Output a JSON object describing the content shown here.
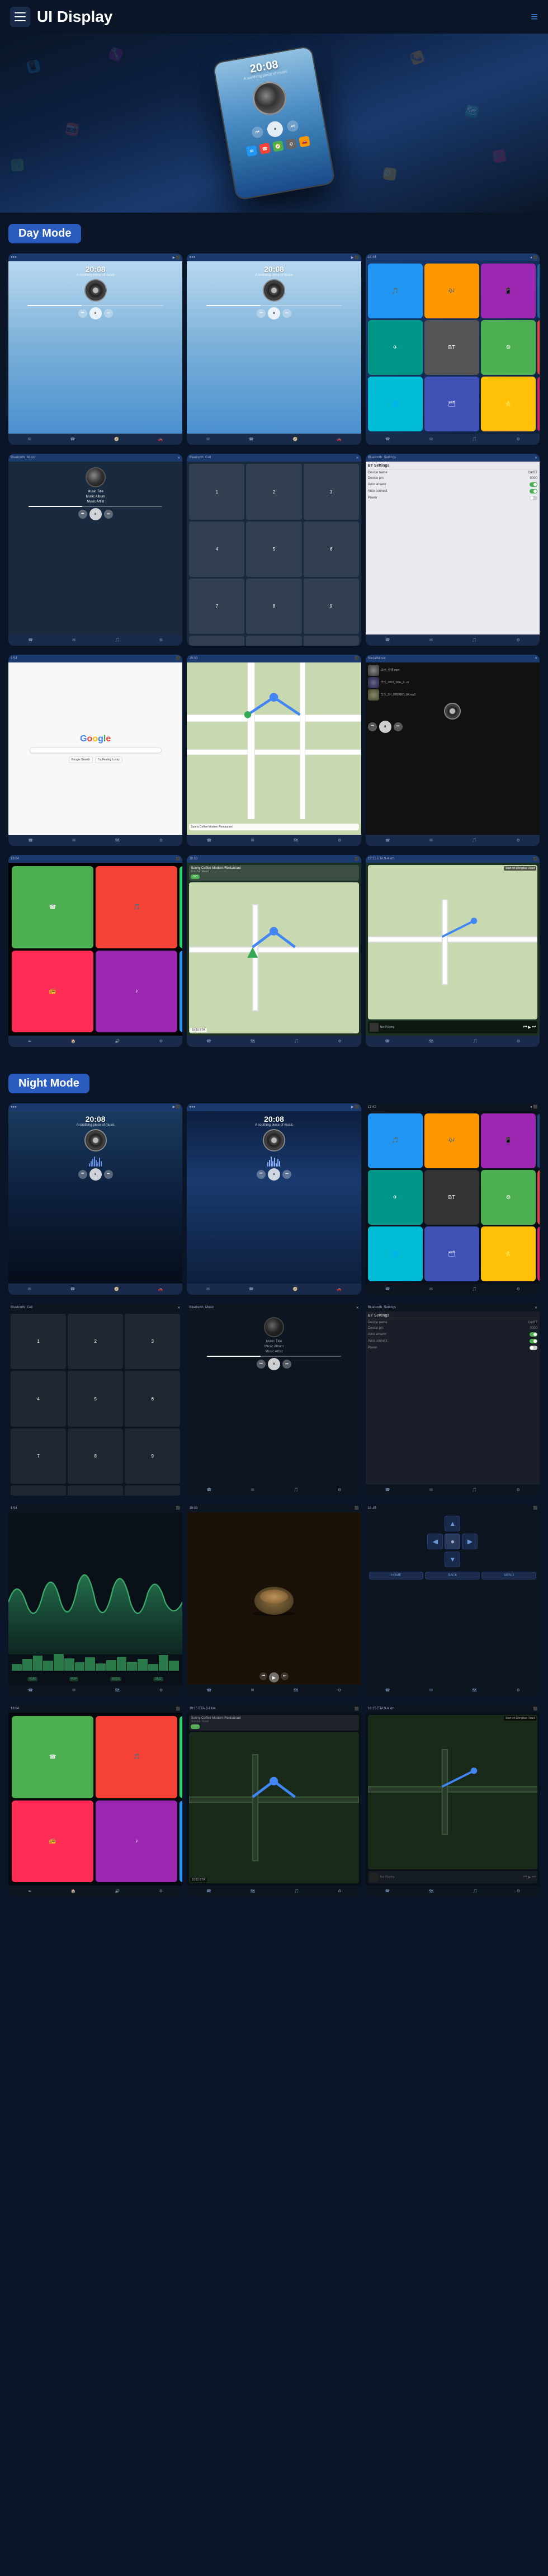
{
  "header": {
    "title": "UI Display",
    "menu_label": "menu",
    "nav_icon": "≡"
  },
  "day_mode": {
    "label": "Day Mode",
    "screenshots": [
      {
        "type": "music",
        "time": "20:08",
        "subtitle": "A soothing piece of music"
      },
      {
        "type": "music2",
        "time": "20:08",
        "subtitle": "A soothing piece of music"
      },
      {
        "type": "appgrid"
      },
      {
        "type": "bluetooth_music",
        "title": "Bluetooth_Music",
        "track": "Music Title",
        "album": "Music Album",
        "artist": "Music Artist"
      },
      {
        "type": "phone_call",
        "title": "Bluetooth_Call"
      },
      {
        "type": "settings",
        "title": "Bluetooth_Settings"
      },
      {
        "type": "google"
      },
      {
        "type": "map"
      },
      {
        "type": "social_music",
        "title": "SocialMusic"
      }
    ]
  },
  "day_mode_row2": {
    "screenshots": [
      {
        "type": "carplay_apps"
      },
      {
        "type": "nav_map"
      },
      {
        "type": "nav_mini"
      }
    ]
  },
  "night_mode": {
    "label": "Night Mode",
    "screenshots": [
      {
        "type": "music_night",
        "time": "20:08",
        "subtitle": "A soothing piece of music"
      },
      {
        "type": "music_night2",
        "time": "20:08",
        "subtitle": "A soothing piece of music"
      },
      {
        "type": "appgrid_night"
      },
      {
        "type": "phone_call_night",
        "title": "Bluetooth_Call"
      },
      {
        "type": "bluetooth_music_night",
        "title": "Bluetooth_Music",
        "track": "Music Title",
        "album": "Music Album",
        "artist": "Music Artist"
      },
      {
        "type": "settings_night",
        "title": "Bluetooth_Settings"
      },
      {
        "type": "waveform_night"
      },
      {
        "type": "food_photo"
      },
      {
        "type": "nav_arrows"
      }
    ]
  },
  "night_mode_row2": {
    "screenshots": [
      {
        "type": "carplay_apps_night"
      },
      {
        "type": "nav_map_night"
      },
      {
        "type": "nav_mini_night"
      }
    ]
  },
  "music_info": {
    "title": "Music Title",
    "album": "Music Album",
    "artist": "Music Artist"
  },
  "night_mode_label": "Night Mode",
  "day_mode_label": "Day Mode",
  "settings": {
    "device_name_label": "Device name",
    "device_name_value": "CarBT",
    "device_pin_label": "Device pin",
    "device_pin_value": "0000",
    "auto_answer_label": "Auto answer",
    "auto_connect_label": "Auto connect",
    "power_label": "Power"
  },
  "time_display": "20:08",
  "subtitle_text": "A soothing piece of music"
}
